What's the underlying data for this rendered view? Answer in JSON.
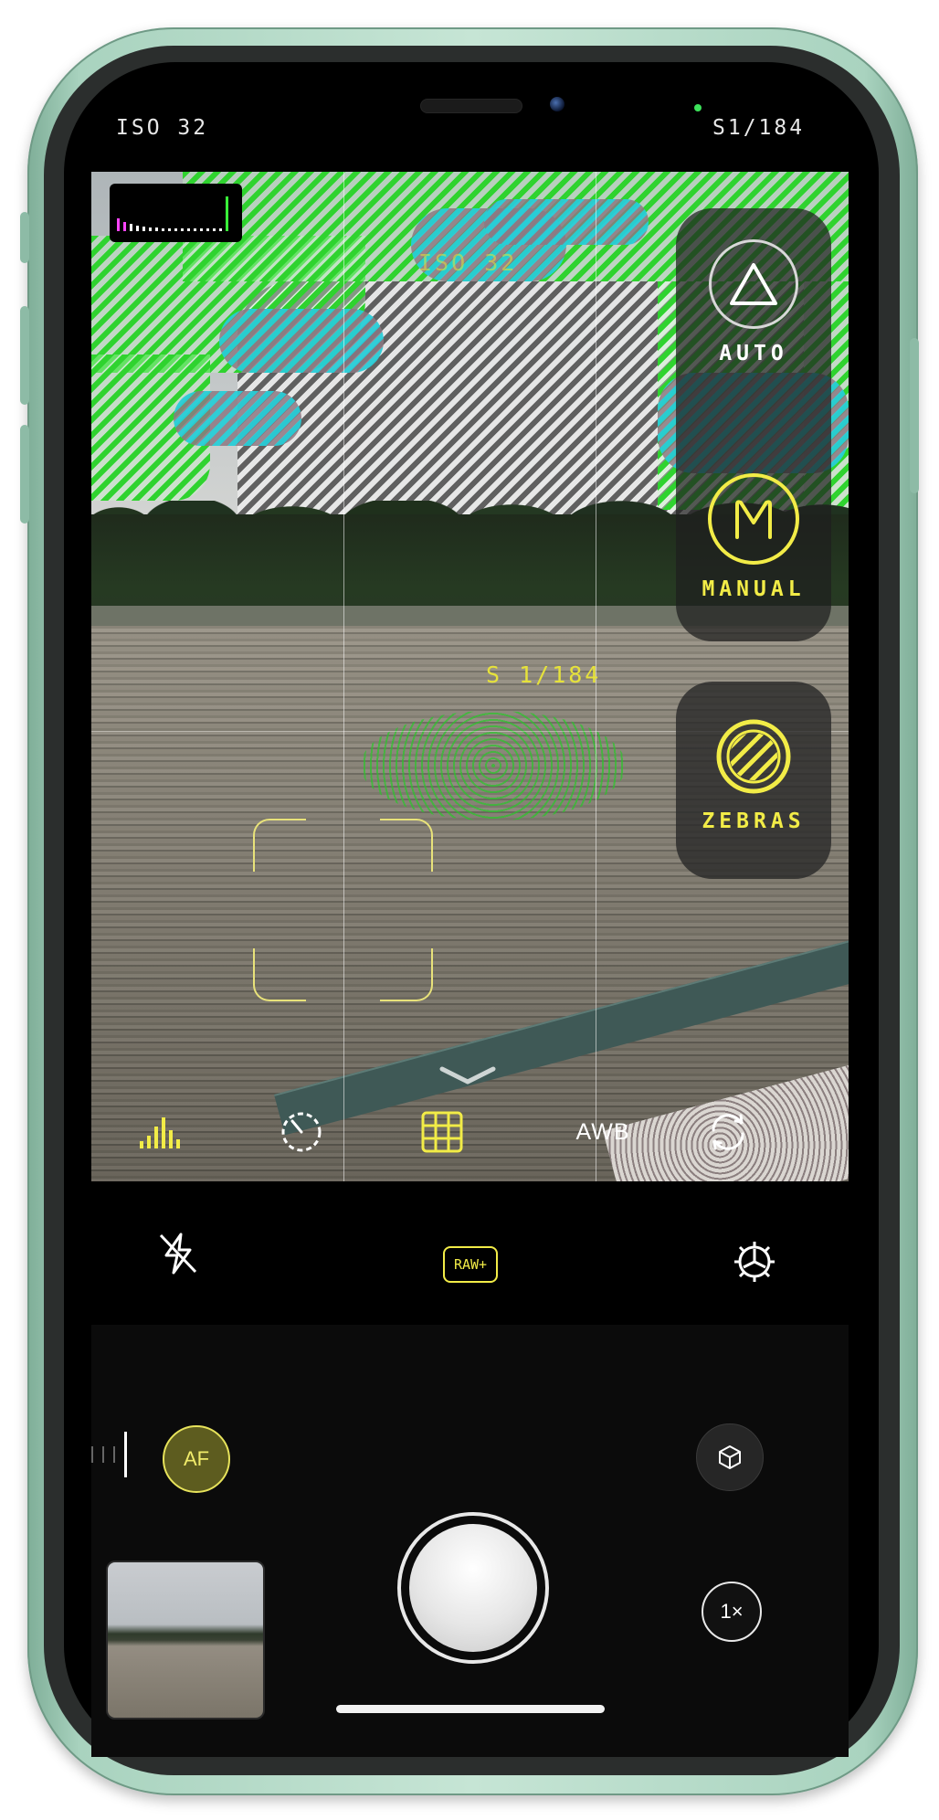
{
  "status_bar": {
    "iso": "ISO 32",
    "shutter": "S1/184"
  },
  "viewfinder": {
    "iso_overlay": "ISO 32",
    "shutter_overlay": "S 1/184"
  },
  "modes": [
    {
      "label": "AUTO",
      "icon": "triangle-icon",
      "color": "#ffffff"
    },
    {
      "label": "MANUAL",
      "icon": "manual-m-icon",
      "color": "#f2ec47"
    },
    {
      "label": "ZEBRAS",
      "icon": "zebras-icon",
      "color": "#f2ec47"
    }
  ],
  "toolbar": {
    "histogram_icon": "histogram-icon",
    "timer_icon": "timer-icon",
    "grid_icon": "grid-icon",
    "awb_label": "AWB",
    "flip_icon": "flip-camera-icon"
  },
  "controls": {
    "flash_icon": "flash-off-icon",
    "raw_label": "RAW+",
    "settings_icon": "settings-icon"
  },
  "bottom": {
    "af_label": "AF",
    "zoom_label": "1×",
    "cube_icon": "cube-icon",
    "shutter_icon": "shutter-button"
  },
  "colors": {
    "accent": "#f2ec47",
    "zebra_green": "#2fd32f",
    "zebra_cyan": "#28cdd7"
  }
}
